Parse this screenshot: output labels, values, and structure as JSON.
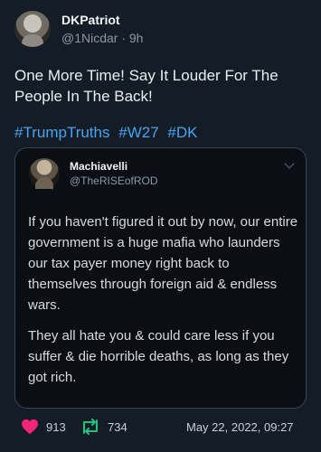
{
  "author": {
    "name": "DKPatriot",
    "meta": "@1Nicdar · 9h"
  },
  "tweet": {
    "text": "One More Time! Say It Louder For The People In The Back!",
    "hashtags": [
      "#TrumpTruths",
      "#W27",
      "#DK"
    ]
  },
  "quoted": {
    "name": "Machiavelli",
    "handle": "@TheRISEofROD",
    "paragraphs": [
      "If you haven't figured it out by now, our entire government is a huge mafia who launders our tax payer money right back to themselves through foreign aid & endless wars.",
      "They all hate you & could care less if you suffer & die horrible deaths, as long as they got rich."
    ]
  },
  "stats": {
    "likes": "913",
    "retweets": "734",
    "timestamp": "May 22, 2022, 09:27"
  },
  "colors": {
    "background": "#141d26",
    "link": "#4aa3f0",
    "heart": "#f4247c",
    "retweet": "#22c37a"
  },
  "icons": [
    "heart-icon",
    "retweet-icon",
    "chevron-down-icon"
  ]
}
